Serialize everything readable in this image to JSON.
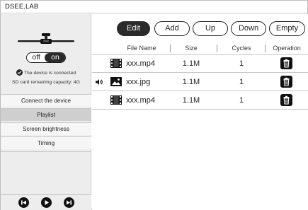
{
  "app": {
    "title": "DSEE.LAB"
  },
  "device": {
    "toggle_off_label": "off",
    "toggle_on_label": "on",
    "state": "on",
    "status_text": "The device is connected",
    "capacity_text": "SD card remaining capacity: 4G"
  },
  "sidebar": {
    "items": [
      {
        "label": "Connect the device",
        "active": false
      },
      {
        "label": "Playlist",
        "active": true
      },
      {
        "label": "Screen brightness",
        "active": false
      },
      {
        "label": "Timing",
        "active": false
      }
    ]
  },
  "player": {
    "prev_icon": "skip-previous-icon",
    "play_icon": "play-icon",
    "next_icon": "skip-next-icon"
  },
  "toolbar": {
    "edit_label": "Edit",
    "add_label": "Add",
    "up_label": "Up",
    "down_label": "Down",
    "empty_label": "Empty"
  },
  "table": {
    "headers": {
      "name": "File Name",
      "size": "Size",
      "cycles": "Cycles",
      "operation": "Operation"
    },
    "rows": [
      {
        "type": "video",
        "name": "xxx.mp4",
        "size": "1.1M",
        "cycles": "1",
        "playing": false
      },
      {
        "type": "image",
        "name": "xxx.jpg",
        "size": "1.1M",
        "cycles": "1",
        "playing": true
      },
      {
        "type": "video",
        "name": "xxx.mp4",
        "size": "1.1M",
        "cycles": "1",
        "playing": false
      }
    ]
  },
  "colors": {
    "accent": "#2b2b2b",
    "sidebar_bg": "#ededed",
    "active_item": "#cfcfcf",
    "border": "#c8c8c8"
  }
}
